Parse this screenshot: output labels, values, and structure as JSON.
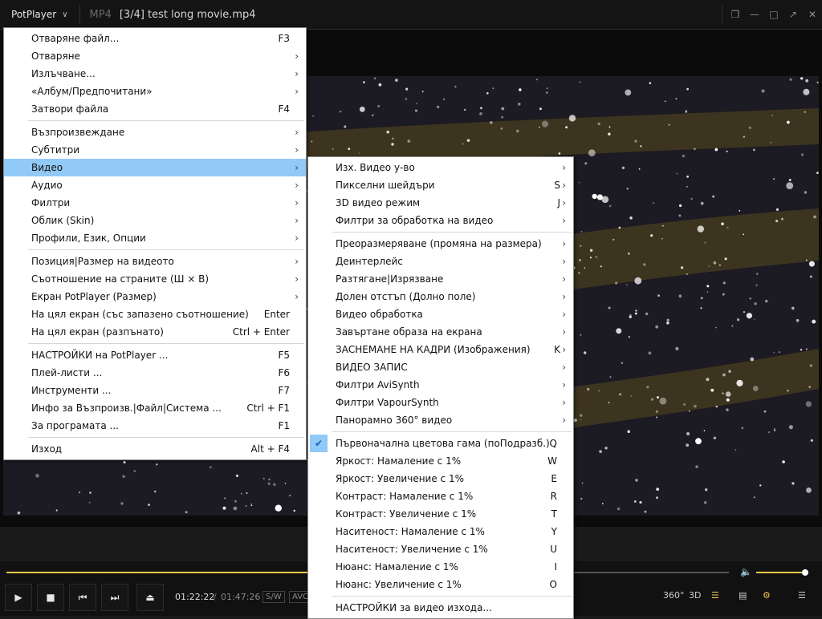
{
  "titlebar": {
    "app_name": "PotPlayer",
    "format": "MP4",
    "title": "[3/4] test long movie.mp4"
  },
  "playback": {
    "current_time": "01:22:22",
    "separator": "/",
    "total_time": "01:47:26",
    "progress": 0.77,
    "volume": 0.95,
    "sw_label": "S/W",
    "avc_label": "AVC",
    "label_360": "360°",
    "label_3d": "3D"
  },
  "main_menu": {
    "groups": [
      [
        {
          "label": "Отваряне файл...",
          "shortcut": "F3",
          "submenu": false
        },
        {
          "label": "Отваряне",
          "shortcut": "",
          "submenu": true
        },
        {
          "label": "Излъчване...",
          "shortcut": "",
          "submenu": true
        },
        {
          "label": "«Албум/Предпочитани»",
          "shortcut": "",
          "submenu": true
        },
        {
          "label": "Затвори файла",
          "shortcut": "F4",
          "submenu": false
        }
      ],
      [
        {
          "label": "Възпроизвеждане",
          "shortcut": "",
          "submenu": true
        },
        {
          "label": "Субтитри",
          "shortcut": "",
          "submenu": true
        },
        {
          "label": "Видео",
          "shortcut": "",
          "submenu": true,
          "highlighted": true
        },
        {
          "label": "Аудио",
          "shortcut": "",
          "submenu": true
        },
        {
          "label": "Филтри",
          "shortcut": "",
          "submenu": true
        },
        {
          "label": "Облик (Skin)",
          "shortcut": "",
          "submenu": true
        },
        {
          "label": "Профили, Език, Опции",
          "shortcut": "",
          "submenu": true
        }
      ],
      [
        {
          "label": "Позиция|Размер на видеото",
          "shortcut": "",
          "submenu": true
        },
        {
          "label": "Съотношение на страните (Ш × В)",
          "shortcut": "",
          "submenu": true
        },
        {
          "label": "Екран PotPlayer (Размер)",
          "shortcut": "",
          "submenu": true
        },
        {
          "label": "На цял екран (със запазено съотношение)",
          "shortcut": "Enter",
          "submenu": false
        },
        {
          "label": "На цял екран (разпънато)",
          "shortcut": "Ctrl + Enter",
          "submenu": false
        }
      ],
      [
        {
          "label": "НАСТРОЙКИ на PotPlayer ...",
          "shortcut": "F5",
          "submenu": false
        },
        {
          "label": "Плей-листи ...",
          "shortcut": "F6",
          "submenu": false
        },
        {
          "label": "Инструменти ...",
          "shortcut": "F7",
          "submenu": false
        },
        {
          "label": "Инфо за Възпроизв.|Файл|Система ...",
          "shortcut": "Ctrl + F1",
          "submenu": false
        },
        {
          "label": "За програмата ...",
          "shortcut": "F1",
          "submenu": false
        }
      ],
      [
        {
          "label": "Изход",
          "shortcut": "Alt + F4",
          "submenu": false
        }
      ]
    ]
  },
  "video_submenu": {
    "groups": [
      [
        {
          "label": "Изх. Видео у-во",
          "shortcut": "",
          "submenu": true
        },
        {
          "label": "Пикселни шейдъри",
          "shortcut": "S",
          "submenu": true
        },
        {
          "label": "3D видео режим",
          "shortcut": "J",
          "submenu": true
        },
        {
          "label": "Филтри за обработка на видео",
          "shortcut": "",
          "submenu": true
        }
      ],
      [
        {
          "label": "Преоразмеряване (промяна на размера)",
          "shortcut": "",
          "submenu": true
        },
        {
          "label": "Деинтерлейс",
          "shortcut": "",
          "submenu": true
        },
        {
          "label": "Разтягане|Изрязване",
          "shortcut": "",
          "submenu": true
        },
        {
          "label": "Долен отстъп (Долно поле)",
          "shortcut": "",
          "submenu": true
        },
        {
          "label": "Видео обработка",
          "shortcut": "",
          "submenu": true
        },
        {
          "label": "Завъртане образа на екрана",
          "shortcut": "",
          "submenu": true
        },
        {
          "label": "ЗАСНЕМАНЕ НА КАДРИ (Изображения)",
          "shortcut": "K",
          "submenu": true
        },
        {
          "label": "ВИДЕО ЗАПИС",
          "shortcut": "",
          "submenu": true
        },
        {
          "label": "Филтри AviSynth",
          "shortcut": "",
          "submenu": true
        },
        {
          "label": "Филтри VapourSynth",
          "shortcut": "",
          "submenu": true
        },
        {
          "label": "Панорамно 360° видео",
          "shortcut": "",
          "submenu": true
        }
      ],
      [
        {
          "label": "Първоначална цветова гама (поПодразб.)",
          "shortcut": "Q",
          "submenu": false,
          "checked": true
        },
        {
          "label": "Яркост: Намаление с 1%",
          "shortcut": "W",
          "submenu": false
        },
        {
          "label": "Яркост: Увеличение с 1%",
          "shortcut": "E",
          "submenu": false
        },
        {
          "label": "Контраст: Намаление с 1%",
          "shortcut": "R",
          "submenu": false
        },
        {
          "label": "Контраст: Увеличение с 1%",
          "shortcut": "T",
          "submenu": false
        },
        {
          "label": "Наситеност: Намаление с 1%",
          "shortcut": "Y",
          "submenu": false
        },
        {
          "label": "Наситеност: Увеличение с 1%",
          "shortcut": "U",
          "submenu": false
        },
        {
          "label": "Нюанс: Намаление с 1%",
          "shortcut": "I",
          "submenu": false
        },
        {
          "label": "Нюанс: Увеличение с 1%",
          "shortcut": "O",
          "submenu": false
        }
      ],
      [
        {
          "label": "НАСТРОЙКИ за видео изхода...",
          "shortcut": "",
          "submenu": false
        }
      ]
    ]
  },
  "colors": {
    "accent": "#f2c94c",
    "menu_highlight": "#91c9f7"
  }
}
